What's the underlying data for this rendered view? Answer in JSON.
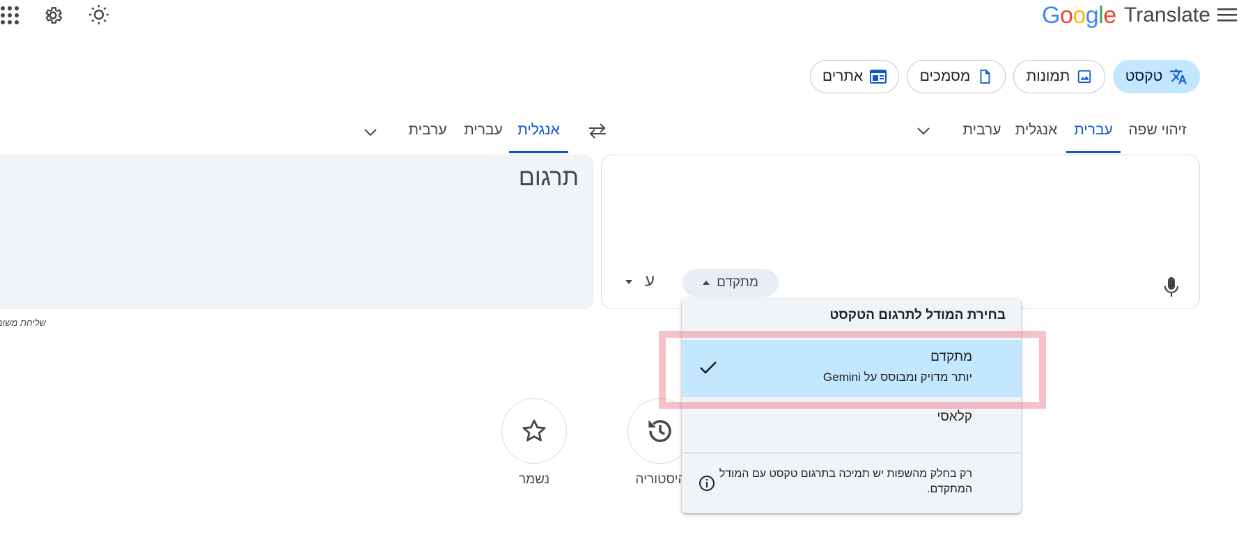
{
  "header": {
    "logo_text": "Google",
    "app_name": "Translate",
    "icons": [
      "apps-grid-icon",
      "settings-gear-icon",
      "theme-sun-icon",
      "main-menu-icon"
    ]
  },
  "modes": [
    {
      "label": "טקסט",
      "icon": "translate-icon",
      "active": true
    },
    {
      "label": "תמונות",
      "icon": "image-icon",
      "active": false
    },
    {
      "label": "מסמכים",
      "icon": "document-icon",
      "active": false
    },
    {
      "label": "אתרים",
      "icon": "website-icon",
      "active": false
    }
  ],
  "source_langs": {
    "detect": "זיהוי שפה",
    "items": [
      "עברית",
      "אנגלית",
      "ערבית"
    ],
    "selected": "עברית"
  },
  "target_langs": {
    "items": [
      "אנגלית",
      "עברית",
      "ערבית"
    ],
    "selected": "אנגלית"
  },
  "target_panel": {
    "placeholder": "תרגום"
  },
  "source_panel": {
    "model_button_label": "מתקדם",
    "keyboard_glyph": "ע"
  },
  "send_feedback_text": "שליחת משוב",
  "bottom_buttons": [
    {
      "label": "היסטוריה",
      "icon": "history-icon"
    },
    {
      "label": "נשמר",
      "icon": "star-icon"
    }
  ],
  "model_menu": {
    "title": "בחירת המודל לתרגום הטקסט",
    "options": [
      {
        "title": "מתקדם",
        "subtitle": "יותר מדויק ומבוסס על Gemini",
        "selected": true
      },
      {
        "title": "קלאסי",
        "subtitle": "",
        "selected": false
      }
    ],
    "note": "רק בחלק מהשפות יש תמיכה בתרגום טקסט עם המודל המתקדם."
  },
  "colors": {
    "accent_blue": "#0b57d0",
    "chip_active_bg": "#c2e7ff",
    "panel_bg": "#f0f4f9",
    "highlight": "#ea7887"
  }
}
